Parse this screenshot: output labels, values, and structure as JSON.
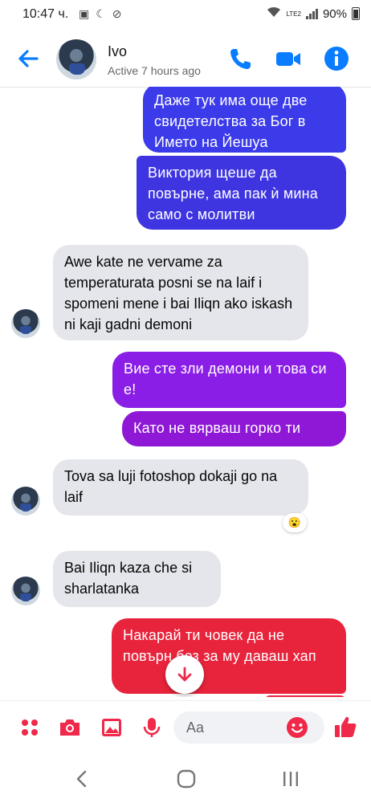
{
  "status_bar": {
    "time": "10:47 ч.",
    "battery": "90%",
    "network_label": "LTE2"
  },
  "header": {
    "contact_name": "Ivo",
    "active_status": "Active 7 hours ago",
    "icons": [
      "back-arrow-icon",
      "phone-icon",
      "video-camera-icon",
      "info-icon"
    ]
  },
  "messages": [
    {
      "from": "me",
      "text": "Даже тук има още две свидетелства за Бог в Името на Йешуа",
      "color": "#3b3bea"
    },
    {
      "from": "me",
      "text": "Виктория щеше да повърне, ама пак ѝ мина само с молитви",
      "color": "#3e35e0"
    },
    {
      "from": "them",
      "text": "Awe kate ne vervame za temperaturata posni se na laif i spomeni mene i bai Iliqn ako iskash ni kaji gadni demoni"
    },
    {
      "from": "me",
      "text": "Вие сте зли демони и това си е!",
      "color": "#8a1de6"
    },
    {
      "from": "me",
      "text": "Като не вярваш горко ти",
      "color": "#8e18d6"
    },
    {
      "from": "them",
      "text": "Tova sa luji fotoshop dokaji go na laif",
      "reaction": "😮"
    },
    {
      "from": "them",
      "text": "Bai Iliqn kaza che si sharlatanka"
    },
    {
      "from": "me",
      "text": "Накарай ти човек да не повърн без за му даваш хап",
      "color": "#e8243c"
    }
  ],
  "composer": {
    "placeholder": "Aa",
    "accent": "#f02849",
    "icons": [
      "apps-icon",
      "camera-icon",
      "image-icon",
      "microphone-icon",
      "emoji-icon",
      "thumbs-up-icon"
    ]
  },
  "accent_color": "#0a7cff"
}
